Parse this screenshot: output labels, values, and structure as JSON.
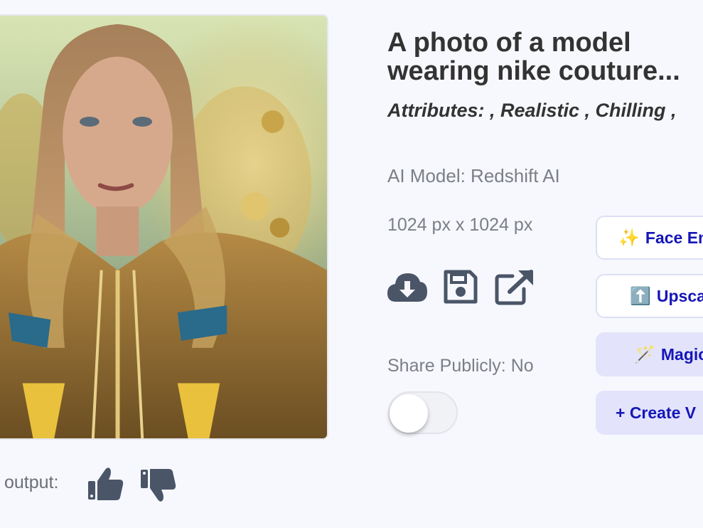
{
  "image": {
    "subject": "model-in-gold-hooded-jacket"
  },
  "feedback": {
    "label": "output:"
  },
  "title": "A photo of a model wearing nike couture...",
  "title_line1": "A photo of a model",
  "title_line2": "wearing nike couture...",
  "attributes": "Attributes:  , Realistic , Chilling  ,",
  "model": "AI Model: Redshift AI",
  "size": "1024 px x 1024 px",
  "share": {
    "label": "Share Publicly: No",
    "enabled": false
  },
  "buttons": {
    "face": {
      "icon": "✨",
      "label": "Face En"
    },
    "upscale": {
      "icon": "⬆️",
      "label": "Upsca"
    },
    "magic": {
      "icon": "🪄",
      "label": "Magic"
    },
    "create": {
      "label": "+ Create V"
    }
  },
  "colors": {
    "accent": "#1616b8",
    "icon": "#4a5568",
    "button_fill": "#e3e4fb",
    "background": "#f7f8fd"
  }
}
